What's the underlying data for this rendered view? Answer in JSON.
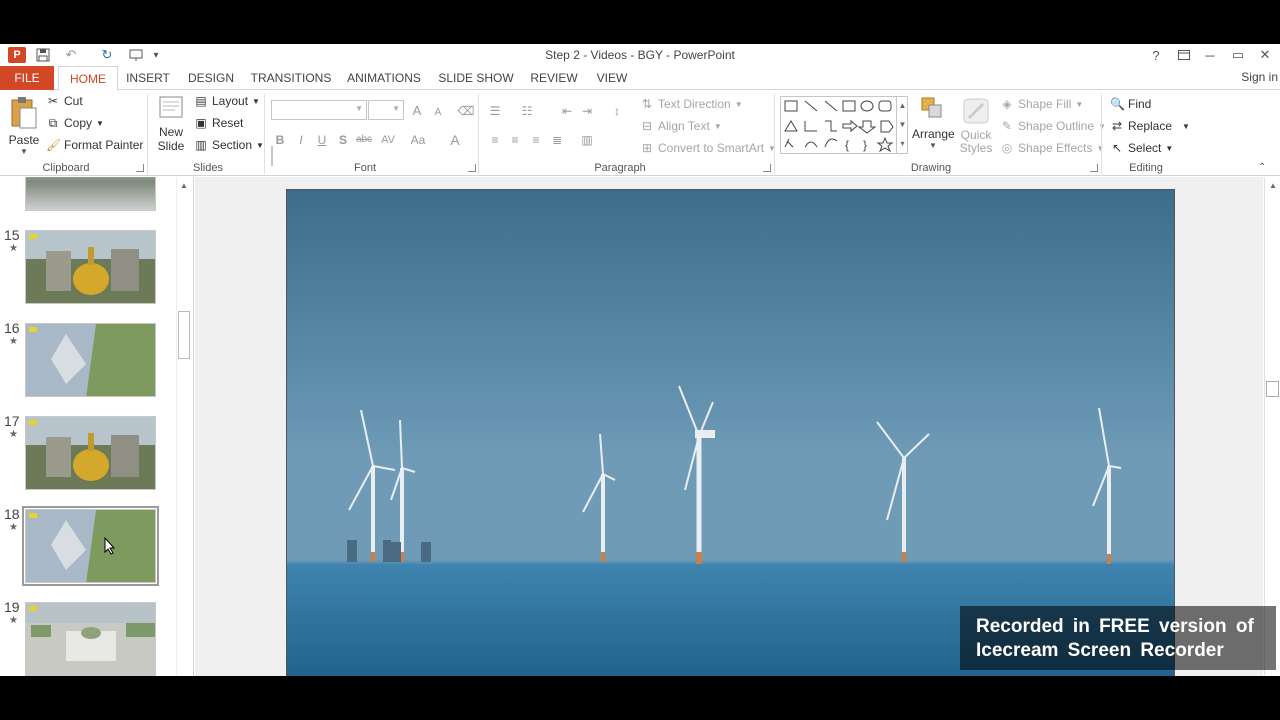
{
  "window": {
    "title": "Step 2 - Videos - BGY - PowerPoint",
    "help": "?",
    "minimize": "─",
    "restore": "▭",
    "close": "✕"
  },
  "qat": {
    "app_icon": "P",
    "save": "💾",
    "undo": "↶",
    "repeat": "↻",
    "more": "▾"
  },
  "tabs": [
    {
      "label": "FILE"
    },
    {
      "label": "HOME"
    },
    {
      "label": "INSERT"
    },
    {
      "label": "DESIGN"
    },
    {
      "label": "TRANSITIONS"
    },
    {
      "label": "ANIMATIONS"
    },
    {
      "label": "SLIDE SHOW"
    },
    {
      "label": "REVIEW"
    },
    {
      "label": "VIEW"
    }
  ],
  "active_tab": "HOME",
  "sign_in": "Sign in",
  "ribbon": {
    "clipboard": {
      "label": "Clipboard",
      "paste": "Paste",
      "cut": "Cut",
      "copy": "Copy",
      "format_painter": "Format Painter"
    },
    "slides": {
      "label": "Slides",
      "new_slide_1": "New",
      "new_slide_2": "Slide",
      "layout": "Layout",
      "reset": "Reset",
      "section": "Section"
    },
    "font": {
      "label": "Font",
      "font_name": "",
      "font_size": "",
      "bold": "B",
      "italic": "I",
      "underline": "U",
      "shadow": "S",
      "strike": "abc",
      "spacing": "AV",
      "case": "Aa",
      "color": "A",
      "grow": "A",
      "shrink": "A"
    },
    "paragraph": {
      "label": "Paragraph",
      "text_direction": "Text Direction",
      "align_text": "Align Text",
      "convert_smartart": "Convert to SmartArt"
    },
    "drawing": {
      "label": "Drawing",
      "arrange": "Arrange",
      "quick_styles_1": "Quick",
      "quick_styles_2": "Styles",
      "shape_fill": "Shape Fill",
      "shape_outline": "Shape Outline",
      "shape_effects": "Shape Effects"
    },
    "editing": {
      "label": "Editing",
      "find": "Find",
      "replace": "Replace",
      "select": "Select"
    }
  },
  "slides": [
    {
      "number": "15",
      "star": "★",
      "scene": "golden-dome"
    },
    {
      "number": "16",
      "star": "★",
      "scene": "aerial-tower"
    },
    {
      "number": "17",
      "star": "★",
      "scene": "golden-dome"
    },
    {
      "number": "18",
      "star": "★",
      "scene": "aerial-tower",
      "selected": true
    },
    {
      "number": "19",
      "star": "★",
      "scene": "mosque-aerial"
    }
  ],
  "slide_main": {
    "scene": "offshore-wind-turbines"
  },
  "watermark": {
    "line1": "Recorded in FREE version of",
    "line2": "Icecream   Screen   Recorder"
  },
  "colors": {
    "accent": "#d24726",
    "sea": "#2a6f96",
    "sky": "#3f6f8c"
  }
}
